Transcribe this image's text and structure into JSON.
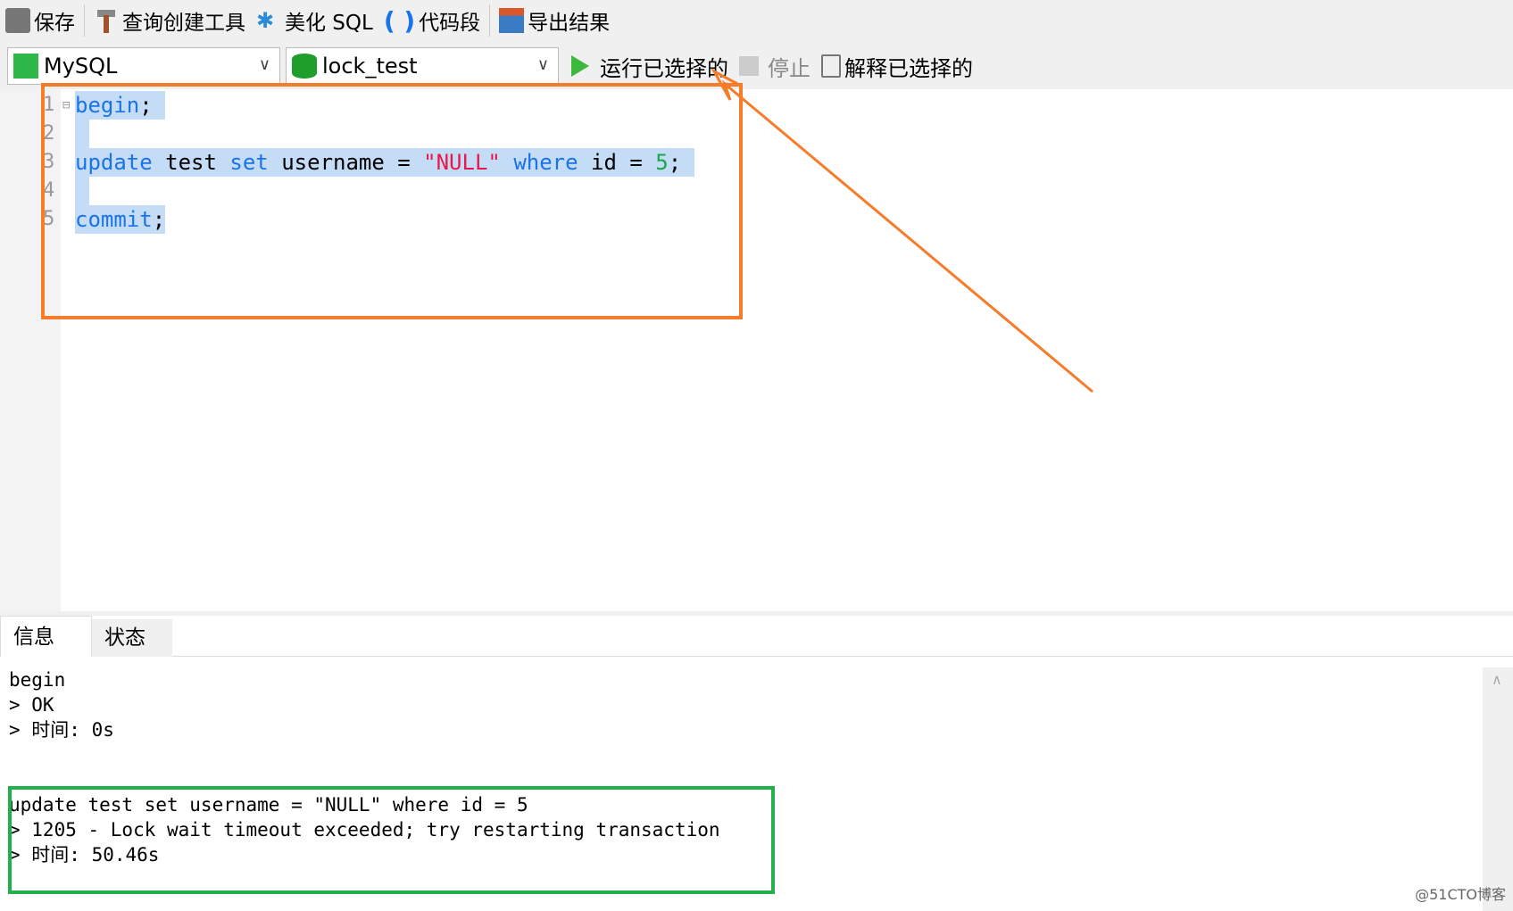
{
  "toolbar": {
    "save": "保存",
    "query_builder": "查询创建工具",
    "beautify": "美化 SQL",
    "snippet": "代码段",
    "export": "导出结果"
  },
  "toolbar2": {
    "connection": "MySQL",
    "database": "lock_test",
    "run_selected": "运行已选择的",
    "stop": "停止",
    "explain_selected": "解释已选择的"
  },
  "editor": {
    "line_numbers": [
      "1",
      "2",
      "3",
      "4",
      "5"
    ],
    "line1": {
      "kw": "begin",
      "rest": ";"
    },
    "line3": {
      "kw1": "update",
      "t1": " test ",
      "kw2": "set",
      "t2": " username = ",
      "str": "\"NULL\"",
      "t3": " ",
      "kw3": "where",
      "t4": " id = ",
      "num": "5",
      "t5": ";"
    },
    "line5": {
      "kw": "commit",
      "rest": ";"
    }
  },
  "tabs": {
    "info": "信息",
    "status": "状态"
  },
  "messages": [
    "begin",
    "> OK",
    "> 时间: 0s",
    "update test set username = \"NULL\" where id = 5",
    "> 1205 - Lock wait timeout exceeded; try restarting transaction",
    "> 时间: 50.46s"
  ],
  "watermark": "@51CTO博客",
  "colors": {
    "annotation_orange": "#f57c2a",
    "annotation_green": "#22b04b",
    "keyword": "#1a73e8"
  }
}
